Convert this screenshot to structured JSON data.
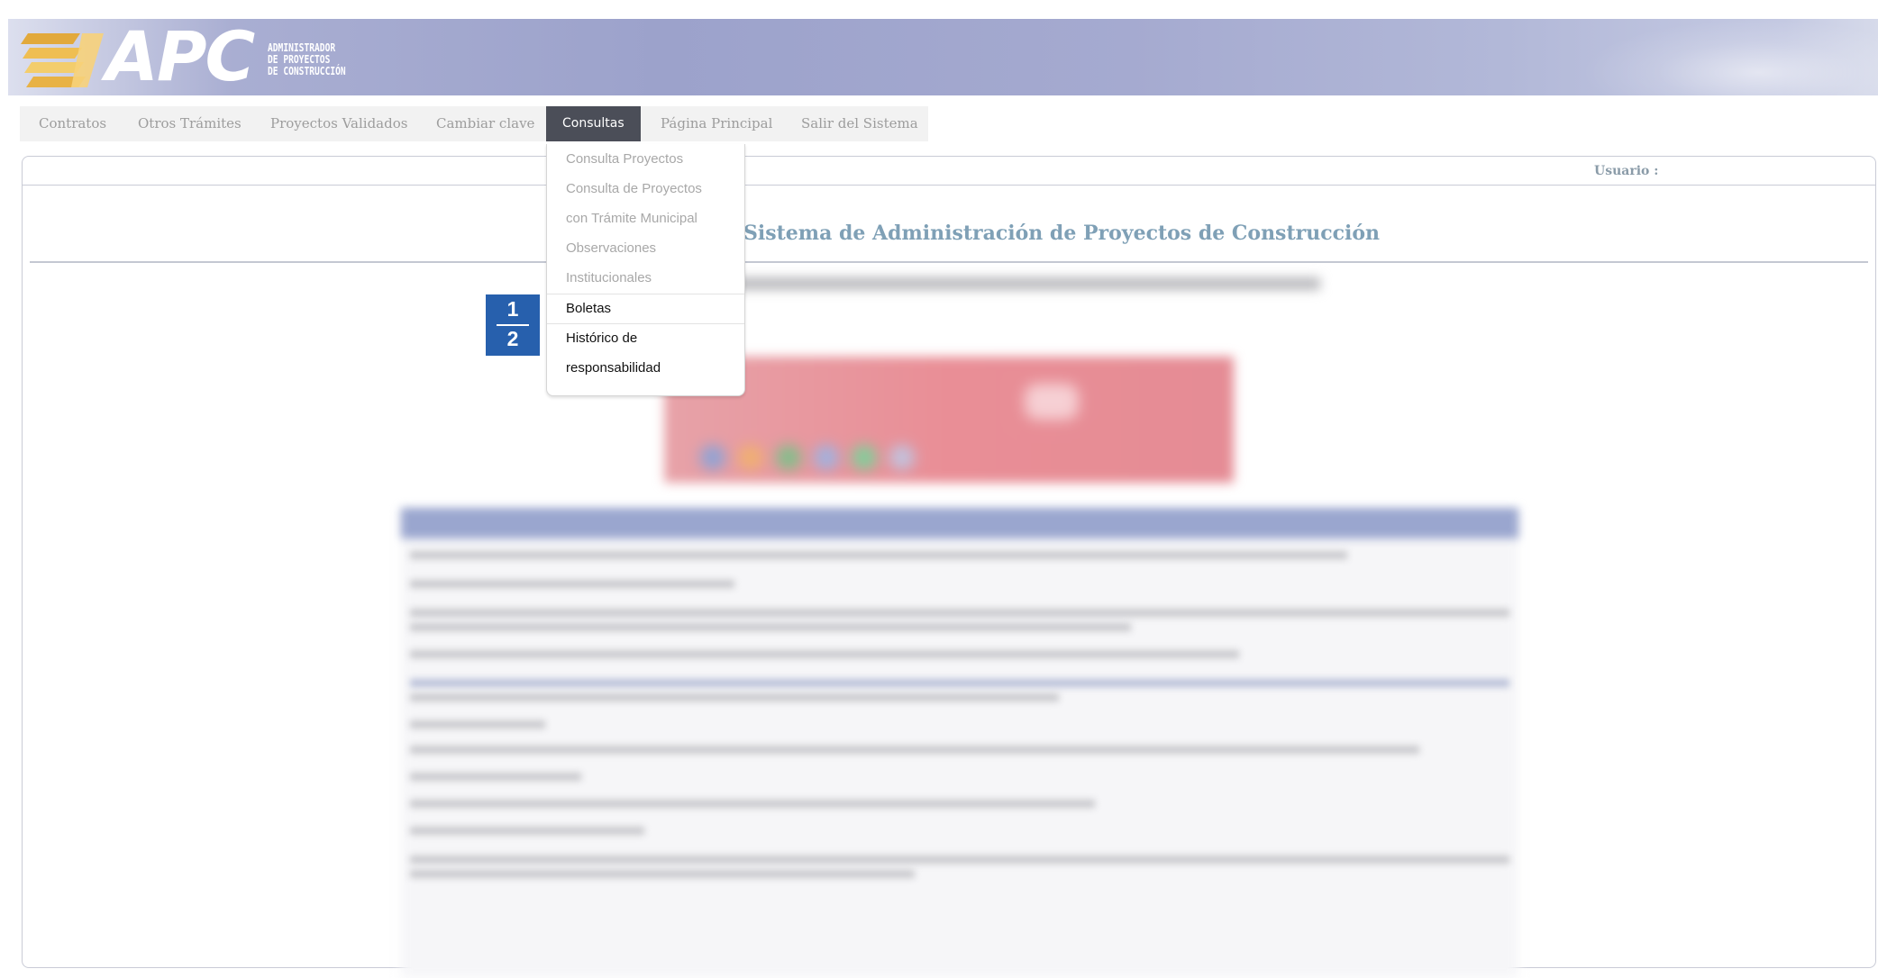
{
  "header": {
    "logo_text": "APC",
    "logo_subtitle": [
      "ADMINISTRADOR",
      "DE PROYECTOS",
      "DE CONSTRUCCIÓN"
    ]
  },
  "menu": {
    "items": [
      {
        "label": "Contratos"
      },
      {
        "label": "Otros Trámites"
      },
      {
        "label": "Proyectos Validados"
      },
      {
        "label": "Cambiar clave"
      },
      {
        "label": "Consultas",
        "active": true
      },
      {
        "label": "Página Principal"
      },
      {
        "label": "Salir del Sistema"
      }
    ]
  },
  "dropdown": {
    "items": [
      {
        "label": "Consulta Proyectos",
        "style": "disabled"
      },
      {
        "label": "Consulta de Proyectos",
        "style": "disabled"
      },
      {
        "label": "con Trámite Municipal",
        "style": "disabled"
      },
      {
        "label": "Observaciones",
        "style": "disabled"
      },
      {
        "label": "Institucionales",
        "style": "disabled"
      },
      {
        "label": "Boletas",
        "style": "enabled"
      },
      {
        "label": "Histórico de",
        "style": "enabled"
      },
      {
        "label": "responsabilidad",
        "style": "enabled"
      }
    ]
  },
  "panel": {
    "user_label": "Usuario :",
    "title": "Sistema de Administración de Proyectos de Construcción"
  },
  "step_badge": {
    "top": "1",
    "bottom": "2"
  },
  "colors": {
    "menu_active_bg": "#4b4e58",
    "title": "#7fa0b6",
    "badge": "#2760ad",
    "banner": "#9ca2cb"
  }
}
